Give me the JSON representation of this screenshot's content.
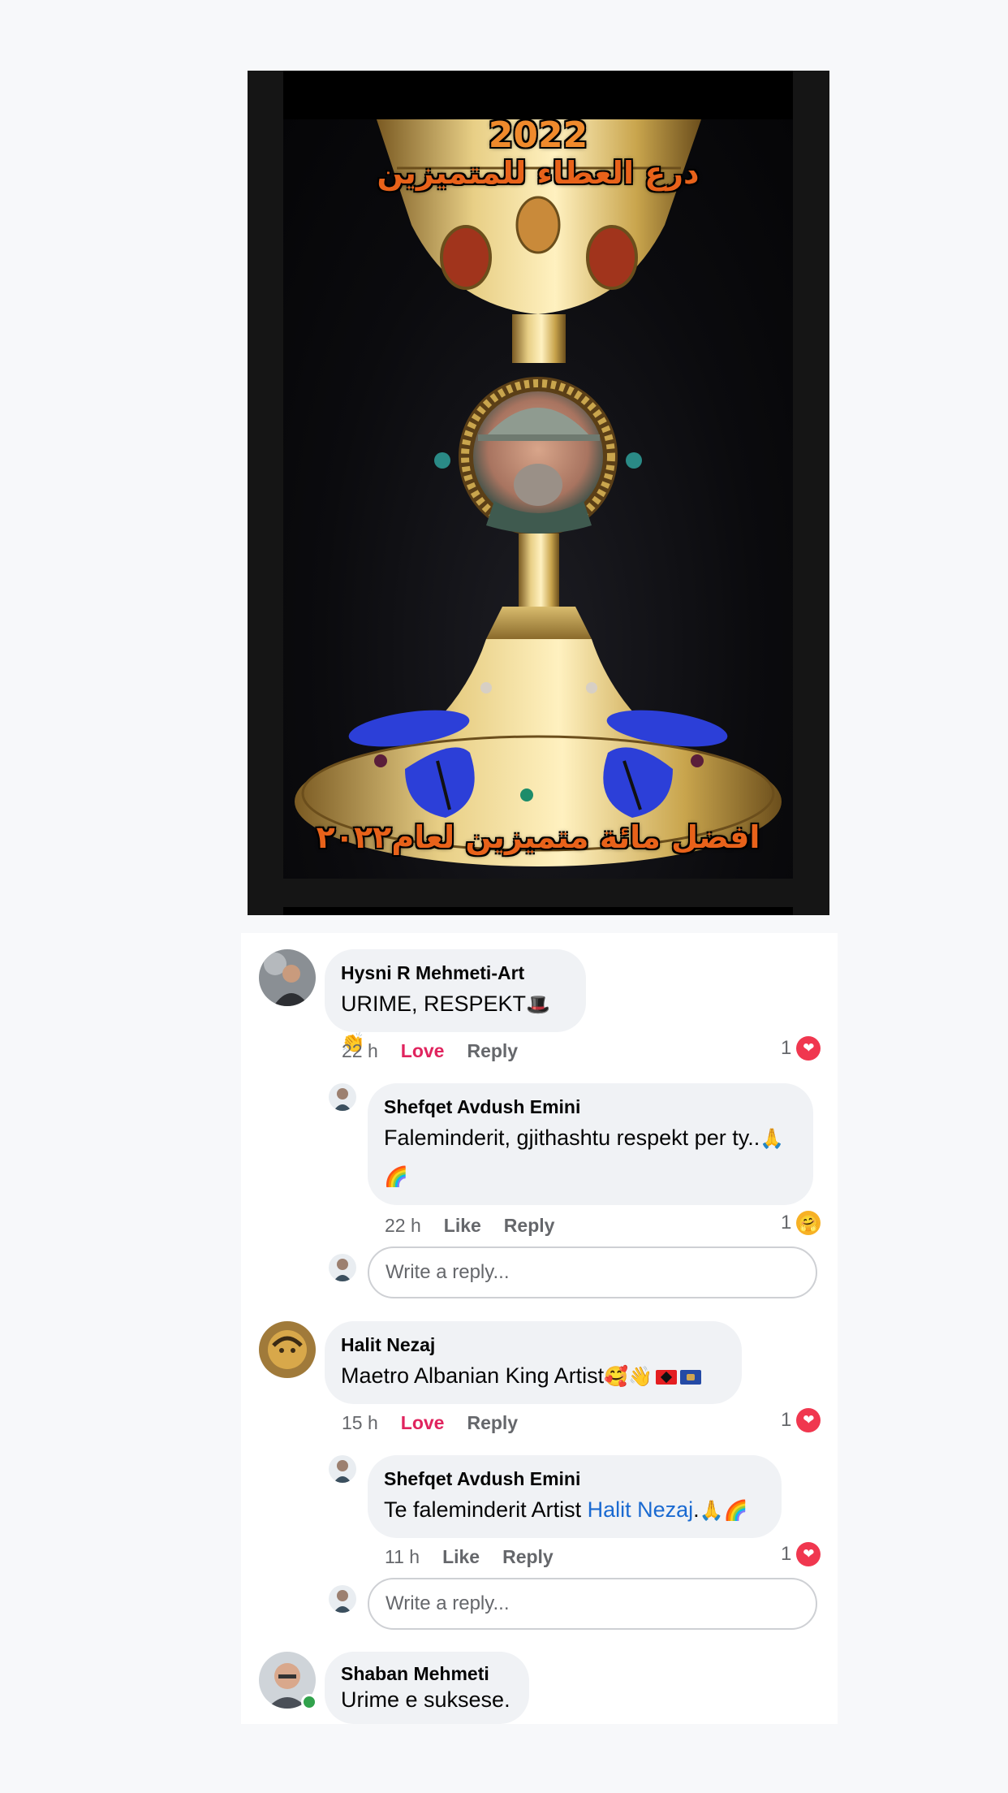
{
  "post_image": {
    "year_text": "2022",
    "top_text": "درع العطاء للمتميزين",
    "bottom_text": "افضل مائة متميزين لعام٢٠٢٢"
  },
  "comments": [
    {
      "author": "Hysni R Mehmeti-Art",
      "text": "URIME, RESPEKT",
      "emojis": "🎩👏",
      "time": "22 h",
      "like_label": "Love",
      "reply_label": "Reply",
      "reaction_count": "1",
      "reaction_icon": "heart-icon",
      "reply": {
        "author": "Shefqet Avdush Emini",
        "text": "Faleminderit, gjithashtu respekt per ty..",
        "emojis_line1": "🙏",
        "emojis_line2": "🌈",
        "time": "22 h",
        "like_label": "Like",
        "reply_label": "Reply",
        "reaction_count": "1",
        "reaction_icon": "care-icon"
      },
      "reply_placeholder": "Write a reply..."
    },
    {
      "author": "Halit Nezaj",
      "text": "Maetro Albanian King Artist",
      "emojis": "🥰👋",
      "time": "15 h",
      "like_label": "Love",
      "reply_label": "Reply",
      "reaction_count": "1",
      "reaction_icon": "heart-icon",
      "reply": {
        "author": "Shefqet Avdush Emini",
        "text_before": "Te faleminderit Artist ",
        "mention": "Halit Nezaj",
        "text_after": ".",
        "emojis": "🙏🌈",
        "time": "11 h",
        "like_label": "Like",
        "reply_label": "Reply",
        "reaction_count": "1",
        "reaction_icon": "heart-icon"
      },
      "reply_placeholder": "Write a reply..."
    },
    {
      "author": "Shaban Mehmeti",
      "text": "Urime e suksese.",
      "online": true
    }
  ],
  "colors": {
    "love": "#e0245e",
    "mention": "#1a6ad1",
    "bubble": "#f0f2f5",
    "online": "#31a24c"
  }
}
